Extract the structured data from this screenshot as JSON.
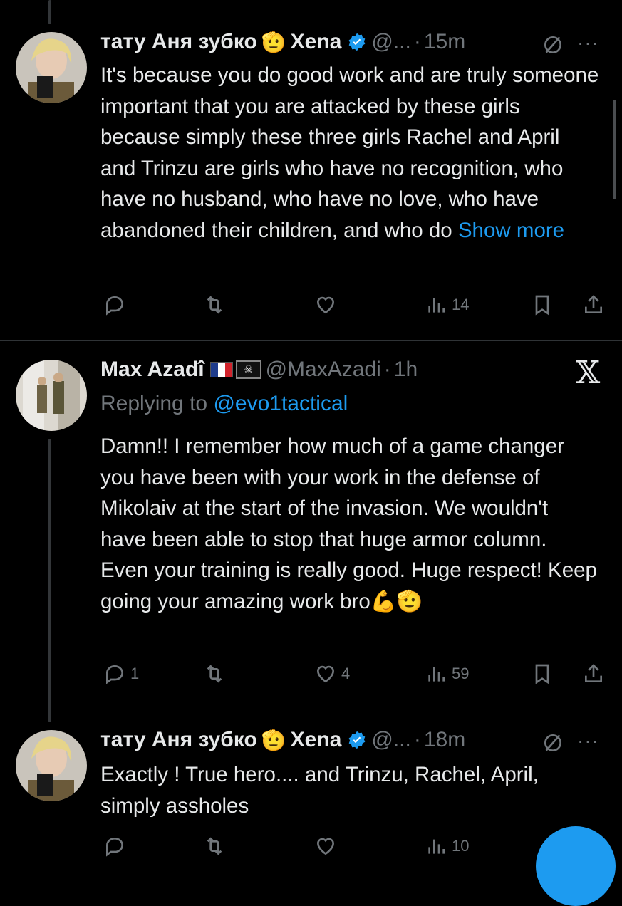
{
  "tweets": [
    {
      "name": "тату Аня зубко",
      "emoji": "🫡",
      "name2": "Xena",
      "handle": "@...",
      "sep": "·",
      "time": "15m",
      "text": "It's because you do good work and are truly someone important that you are attacked by these girls because simply these three girls Rachel and April and Trinzu are girls who have no recognition, who have no husband, who have no love, who have abandoned their children, and who do ",
      "show_more": "Show more",
      "views": "14",
      "replies": "",
      "likes": ""
    },
    {
      "name": "Max Azadî",
      "pirate": "☠",
      "handle": "@MaxAzadi",
      "sep": "·",
      "time": "1h",
      "replying_prefix": "Replying to ",
      "replying_to": "@evo1tactical",
      "text": "Damn!! I remember how much of a game changer you have been with your work in the defense of Mikolaiv at the start of the invasion. We wouldn't have been able to stop that huge armor column. Even your training is really good. Huge respect! Keep going your amazing work bro",
      "text_emoji": "💪🫡",
      "replies": "1",
      "likes": "4",
      "views": "59",
      "x_logo": "𝕏"
    },
    {
      "name": "тату Аня зубко",
      "emoji": "🫡",
      "name2": "Xena",
      "handle": "@...",
      "sep": "·",
      "time": "18m",
      "text": "Exactly ! True hero.... and Trinzu, Rachel, April, simply assholes",
      "views": "10"
    }
  ],
  "colors": {
    "accent": "#1d9bf0",
    "muted": "#71767b",
    "text": "#e7e9ea",
    "bg": "#000000"
  },
  "icons": [
    "reply-icon",
    "retweet-icon",
    "like-icon",
    "views-icon",
    "bookmark-icon",
    "share-icon",
    "grok-icon",
    "more-icon",
    "verified-icon"
  ]
}
